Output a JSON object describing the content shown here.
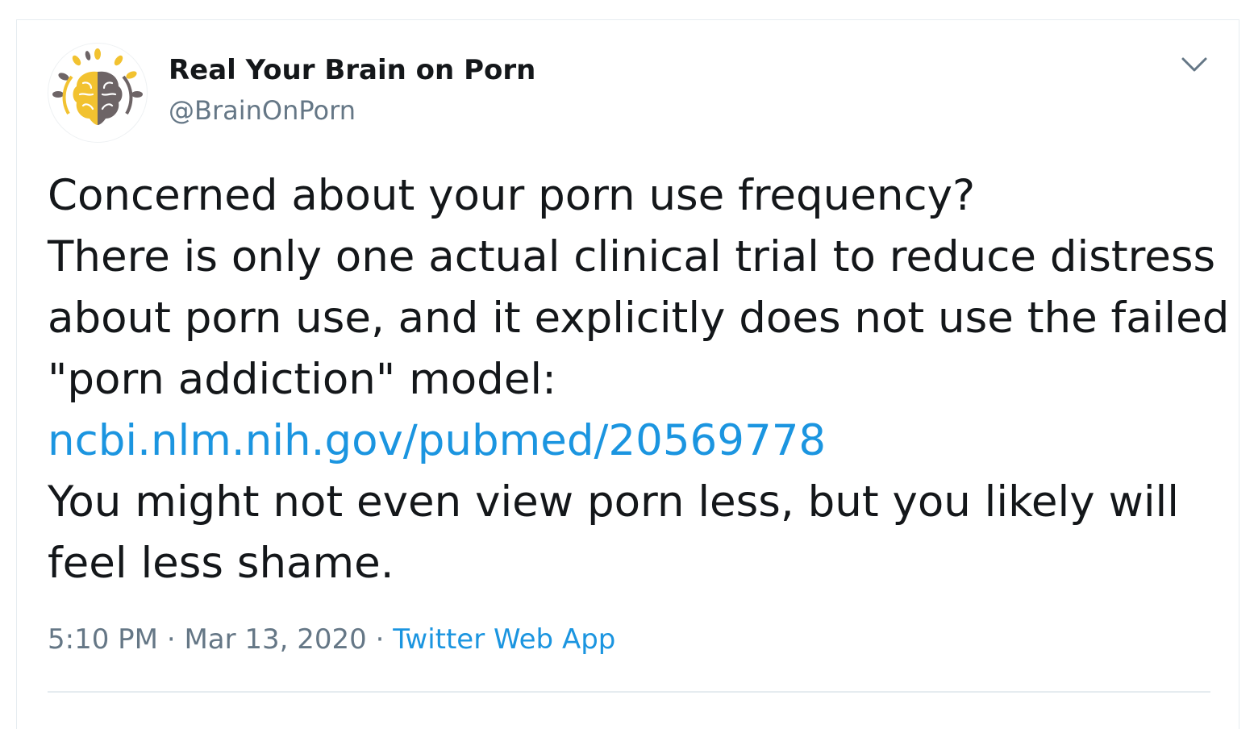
{
  "tweet": {
    "author_name": "Real Your Brain on Porn",
    "author_handle": "@BrainOnPorn",
    "avatar_icon": "brain-logo-icon",
    "more_icon": "chevron-down-icon",
    "lines": [
      "Concerned about your porn use frequency?",
      "There is only one actual clinical trial to reduce distress",
      "about porn use, and it explicitly does not use the failed",
      "\"porn addiction\" model:"
    ],
    "link": "ncbi.nlm.nih.gov/pubmed/20569778",
    "lines_after": [
      "You might not even view porn less, but you likely will",
      "feel less shame."
    ],
    "time": "5:10 PM",
    "date": "Mar 13, 2020",
    "separator": "·",
    "source": "Twitter Web App"
  },
  "colors": {
    "text": "#14171a",
    "secondary": "#657786",
    "link": "#1b95e0",
    "border": "#e6ecf0",
    "brain_yellow": "#f2c230",
    "brain_gray": "#6d6466"
  }
}
